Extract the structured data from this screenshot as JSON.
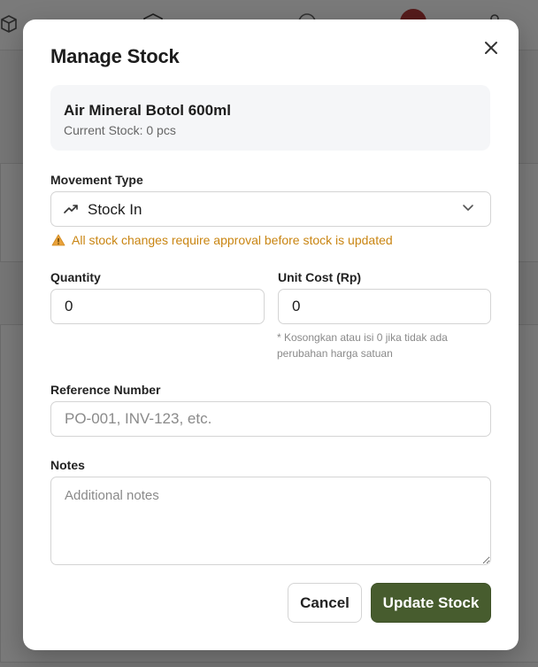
{
  "modal": {
    "title": "Manage Stock",
    "product": {
      "name": "Air Mineral Botol 600ml",
      "current_stock": "Current Stock: 0 pcs"
    },
    "movement_type": {
      "label": "Movement Type",
      "value": "Stock In",
      "icon": "trending-up-icon"
    },
    "warning": {
      "icon": "warning-icon",
      "text": "All stock changes require approval before stock is updated"
    },
    "quantity": {
      "label": "Quantity",
      "value": "0"
    },
    "unit_cost": {
      "label": "Unit Cost (Rp)",
      "value": "0",
      "hint": "* Kosongkan atau isi 0 jika tidak ada perubahan harga satuan"
    },
    "reference": {
      "label": "Reference Number",
      "placeholder": "PO-001, INV-123, etc."
    },
    "notes": {
      "label": "Notes",
      "placeholder": "Additional notes"
    },
    "buttons": {
      "cancel": "Cancel",
      "update": "Update Stock"
    }
  },
  "colors": {
    "primary": "#475c2e",
    "warning": "#c98512",
    "overlay": "rgba(0,0,0,0.52)"
  }
}
